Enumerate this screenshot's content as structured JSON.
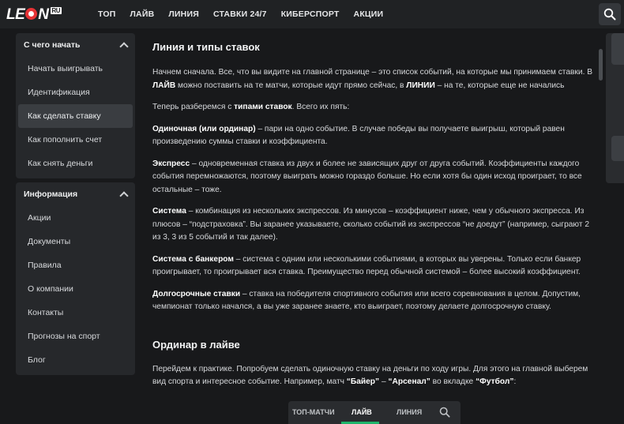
{
  "header": {
    "logo_text": "LEON",
    "logo_suffix": "RU",
    "nav": [
      "ТОП",
      "ЛАЙВ",
      "ЛИНИЯ",
      "СТАВКИ 24/7",
      "КИБЕРСПОРТ",
      "АКЦИИ"
    ]
  },
  "sidebar": {
    "groups": [
      {
        "title": "С чего начать",
        "items": [
          "Начать выигрывать",
          "Идентификация",
          "Как сделать ставку",
          "Как пополнить счет",
          "Как снять деньги"
        ]
      },
      {
        "title": "Информация",
        "items": [
          "Акции",
          "Документы",
          "Правила",
          "О компании",
          "Контакты",
          "Прогнозы на спорт",
          "Блог"
        ]
      }
    ]
  },
  "content": {
    "h1": "Линия и типы ставок",
    "intro": {
      "a": "Начнем сначала. Все, что вы видите на главной странице – это список событий, на которые мы принимаем ставки. В ",
      "b1": "ЛАЙВ",
      "c": " можно поставить на те матчи, которые идут прямо сейчас, в ",
      "b2": "ЛИНИИ",
      "d": " – на те, которые еще не начались"
    },
    "types_intro": {
      "a": "Теперь разберемся с ",
      "b": "типами ставок",
      "c": ". Всего их пять:"
    },
    "types": [
      {
        "term": "Одиночная (или ординар)",
        "text": " – пари на одно событие. В случае победы вы получаете выигрыш, который равен произведению суммы ставки и коэффициента."
      },
      {
        "term": "Экспресс",
        "text": " – одновременная ставка из двух и более не зависящих друг от друга событий. Коэффициенты каждого события перемножаются, поэтому выиграть можно гораздо больше. Но если хотя бы один исход проиграет, то все остальные – тоже."
      },
      {
        "term": "Система",
        "text": " – комбинация из нескольких экспрессов. Из минусов – коэффициент ниже, чем у обычного экспресса. Из плюсов – “подстраховка”. Вы заранее указываете, сколько событий из экспрессов “не доедут” (например, сыграют 2 из 3, 3 из 5 событий и так далее)."
      },
      {
        "term": "Система с банкером",
        "text": " – система с одним или несколькими событиями, в которых вы уверены. Только если банкер проигрывает, то проигрывает вся ставка. Преимущество перед обычной системой – более высокий коэффициент."
      },
      {
        "term": "Долгосрочные ставки",
        "text": " – ставка на победителя спортивного события или всего соревнования в целом. Допустим, чемпионат только начался, а вы уже заранее знаете, кто выиграет, поэтому делаете долгосрочную ставку."
      }
    ],
    "h2": "Ординар в лайве",
    "practice": {
      "a": "Перейдем к практике. Попробуем сделать одиночную ставку на деньги по ходу игры. Для этого на главной выберем вид спорта и интересное событие. Например, матч ",
      "b1": "“Байер”",
      "c": " – ",
      "b2": "“Арсенал”",
      "d": " во вкладке ",
      "b3": "“Футбол”",
      "e": ":"
    }
  },
  "preview": {
    "tabs": [
      "ТОП-МАТЧИ",
      "ЛАЙВ",
      "ЛИНИЯ"
    ],
    "active_tab": "ЛАЙВ"
  },
  "colors": {
    "background": "#18191b",
    "topbar": "#202224",
    "panel": "#26282b",
    "active": "#3a3d41",
    "brand_red": "#e63235",
    "accent_green": "#1fb36a"
  }
}
